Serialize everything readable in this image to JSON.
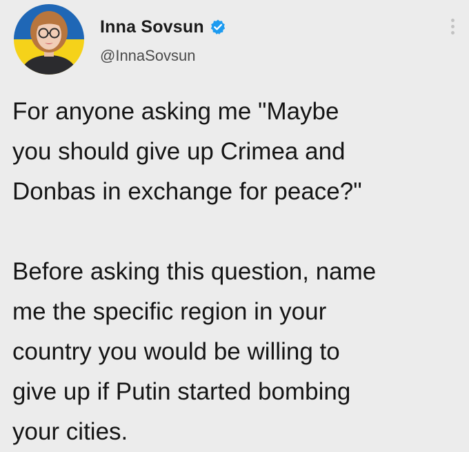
{
  "author": {
    "display_name": "Inna Sovsun",
    "handle": "@InnaSovsun",
    "verified": true,
    "avatar_icon": "profile-photo-icon"
  },
  "tweet": {
    "paragraphs": [
      [
        "For anyone asking me \"Maybe",
        "you should give up Crimea and",
        "Donbas in exchange for peace?\""
      ],
      [
        "Before asking this question, name",
        "me the specific region in your",
        "country you would be willing to",
        "give up if Putin started bombing",
        "your cities."
      ]
    ]
  },
  "colors": {
    "background": "#ececec",
    "verified_badge": "#1d9bf0",
    "flag_blue": "#1f67b6",
    "flag_yellow": "#f5d21a"
  },
  "icons": {
    "verified": "verified-badge-icon",
    "more": "more-options-icon"
  }
}
